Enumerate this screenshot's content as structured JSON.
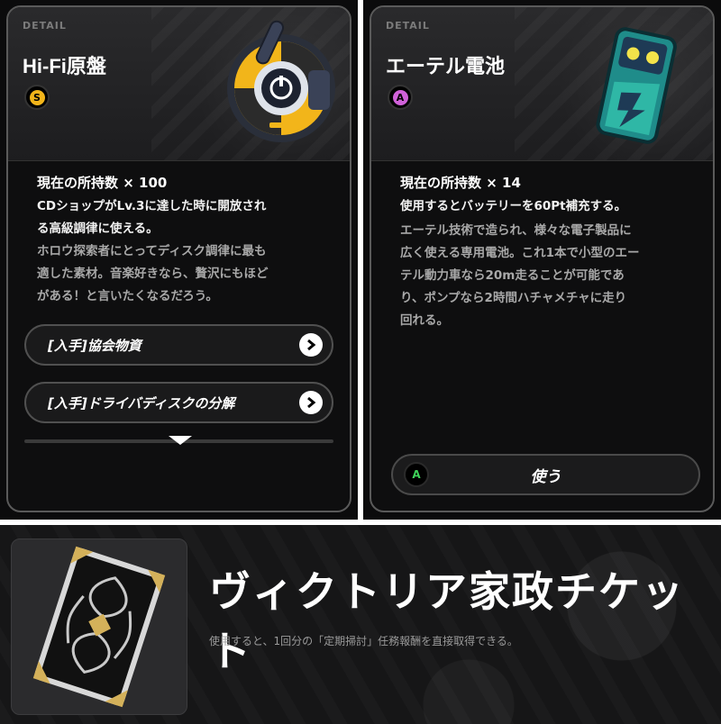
{
  "left_card": {
    "detail_label": "DETAIL",
    "title": "Hi-Fi原盤",
    "rank": "S",
    "count_text": "現在の所持数 × 100",
    "desc_main": [
      "CDショップがLv.3に達した時に開放され",
      "る高級調律に使える。"
    ],
    "desc_flavor": [
      "ホロウ探索者にとってディスク調律に最も",
      "適した素材。音楽好きなら、贅沢にもほど",
      "がある！と言いたくなるだろう。"
    ],
    "sources": [
      {
        "label": "[入手]協会物資"
      },
      {
        "label": "[入手]ドライバディスクの分解"
      }
    ]
  },
  "right_card": {
    "detail_label": "DETAIL",
    "title": "エーテル電池",
    "rank": "A",
    "count_text": "現在の所持数 × 14",
    "desc_main": [
      "使用するとバッテリーを60Pt補充する。"
    ],
    "desc_flavor": [
      "エーテル技術で造られ、様々な電子製品に",
      "広く使える専用電池。これ1本で小型のエー",
      "テル動力車なら20m走ることが可能であ",
      "り、ポンプなら2時間ハチャメチャに走り",
      "回れる。"
    ],
    "use_button": {
      "key": "A",
      "label": "使う"
    }
  },
  "banner": {
    "title": "ヴィクトリア家政チケット",
    "description": "使用すると、1回分の「定期掃討」任務報酬を直接取得できる。"
  },
  "colors": {
    "rank_s": "#f2b51a",
    "rank_a": "#d061d8",
    "a_key": "#3fd35a"
  },
  "icons": [
    "hifi-master-disc-icon",
    "ether-battery-icon",
    "victoria-ticket-icon",
    "chevron-right-icon",
    "more-down-arrow-icon"
  ]
}
